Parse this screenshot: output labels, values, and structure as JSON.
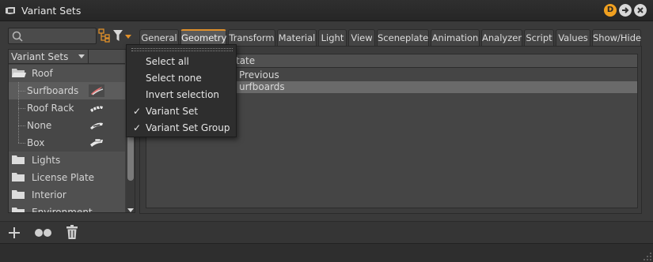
{
  "window": {
    "title": "Variant Sets",
    "badge_letter": "D"
  },
  "icons": {
    "app": "window-icon",
    "search": "search-icon",
    "tree_view": "tree-view-icon",
    "filter": "filter-icon",
    "folder": "folder-icon",
    "add": "plus-icon",
    "group": "group-icon",
    "delete": "trash-icon"
  },
  "colors": {
    "accent": "#e0902a",
    "badge": "#f0a020"
  },
  "search": {
    "placeholder": ""
  },
  "tree": {
    "header": "Variant Sets",
    "items": [
      {
        "label": "Roof",
        "kind": "folder",
        "open": true
      },
      {
        "label": "Surfboards",
        "kind": "child",
        "selected": true
      },
      {
        "label": "Roof Rack",
        "kind": "child"
      },
      {
        "label": "None",
        "kind": "child"
      },
      {
        "label": "Box",
        "kind": "child"
      },
      {
        "label": "Lights",
        "kind": "folder"
      },
      {
        "label": "License Plate",
        "kind": "folder"
      },
      {
        "label": "Interior",
        "kind": "folder"
      },
      {
        "label": "Environment",
        "kind": "folder"
      }
    ]
  },
  "tabs": [
    "General",
    "Geometry",
    "Transform",
    "Material",
    "Light",
    "View",
    "Sceneplate",
    "Animation",
    "Analyzer",
    "Script",
    "Values",
    "Show/Hide"
  ],
  "active_tab": "Geometry",
  "state_table": {
    "header": "tate",
    "rows": [
      {
        "label": "Previous",
        "selected": false
      },
      {
        "label": "urfboards",
        "selected": true
      }
    ]
  },
  "filter_menu": {
    "items": [
      {
        "label": "Select all",
        "checked": false
      },
      {
        "label": "Select none",
        "checked": false
      },
      {
        "label": "Invert selection",
        "checked": false
      },
      {
        "label": "Variant Set",
        "checked": true
      },
      {
        "label": "Variant Set Group",
        "checked": true
      }
    ]
  }
}
